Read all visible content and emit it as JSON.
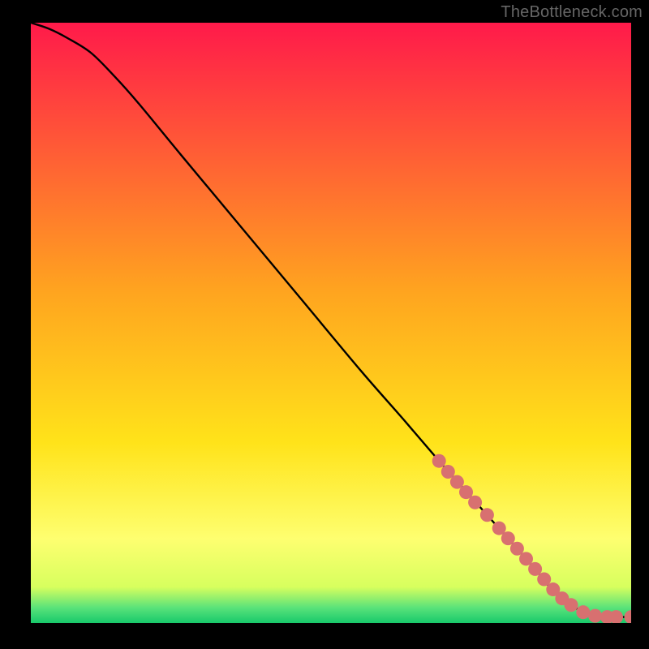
{
  "watermark": "TheBottleneck.com",
  "chart_data": {
    "type": "line",
    "title": "",
    "xlabel": "",
    "ylabel": "",
    "xlim": [
      0,
      100
    ],
    "ylim": [
      0,
      100
    ],
    "grid": false,
    "legend": false,
    "gradient_stops": [
      {
        "offset": 0,
        "color": "#ff1a4a"
      },
      {
        "offset": 0.45,
        "color": "#ffa51f"
      },
      {
        "offset": 0.7,
        "color": "#ffe31a"
      },
      {
        "offset": 0.86,
        "color": "#feff70"
      },
      {
        "offset": 0.94,
        "color": "#d7ff5e"
      },
      {
        "offset": 0.975,
        "color": "#58e27a"
      },
      {
        "offset": 1.0,
        "color": "#18c96b"
      }
    ],
    "curve": {
      "x": [
        0,
        3,
        6,
        10,
        14,
        18,
        25,
        35,
        45,
        55,
        62,
        68,
        72,
        76,
        80,
        84,
        86,
        88,
        90,
        92,
        94,
        96,
        98,
        100
      ],
      "y_pct": [
        100,
        99,
        97.5,
        95,
        91,
        86.5,
        78,
        66,
        54,
        42,
        34,
        27,
        22.5,
        18,
        13.5,
        9,
        6.5,
        4.5,
        3,
        1.8,
        1.2,
        1.0,
        1.0,
        1.0
      ]
    },
    "markers": {
      "color": "#d87070",
      "radius": 8.5,
      "points": [
        {
          "x": 68,
          "y_pct": 27
        },
        {
          "x": 69.5,
          "y_pct": 25.2
        },
        {
          "x": 71,
          "y_pct": 23.5
        },
        {
          "x": 72.5,
          "y_pct": 21.8
        },
        {
          "x": 74,
          "y_pct": 20.1
        },
        {
          "x": 76,
          "y_pct": 18
        },
        {
          "x": 78,
          "y_pct": 15.8
        },
        {
          "x": 79.5,
          "y_pct": 14.1
        },
        {
          "x": 81,
          "y_pct": 12.4
        },
        {
          "x": 82.5,
          "y_pct": 10.7
        },
        {
          "x": 84,
          "y_pct": 9
        },
        {
          "x": 85.5,
          "y_pct": 7.3
        },
        {
          "x": 87,
          "y_pct": 5.6
        },
        {
          "x": 88.5,
          "y_pct": 4.1
        },
        {
          "x": 90,
          "y_pct": 3
        },
        {
          "x": 92,
          "y_pct": 1.8
        },
        {
          "x": 94,
          "y_pct": 1.2
        },
        {
          "x": 96,
          "y_pct": 1.0
        },
        {
          "x": 97.5,
          "y_pct": 1.0
        },
        {
          "x": 100,
          "y_pct": 1.0
        }
      ]
    }
  }
}
